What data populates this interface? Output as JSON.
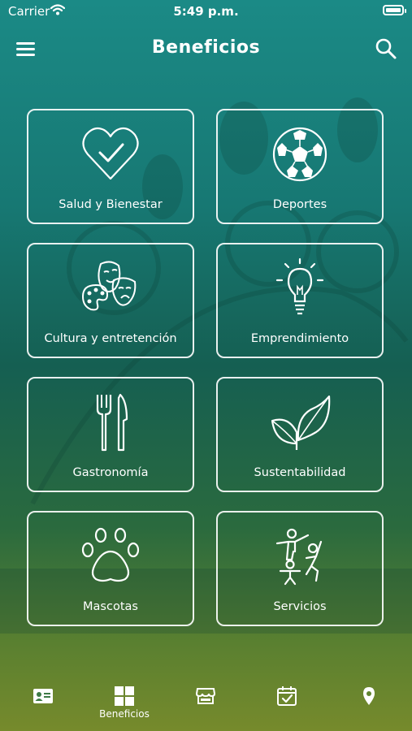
{
  "status_bar": {
    "carrier": "Carrier",
    "time": "5:49 p.m."
  },
  "nav": {
    "title": "Beneficios"
  },
  "categories": [
    {
      "label": "Salud y Bienestar",
      "icon": "heart-check-icon"
    },
    {
      "label": "Deportes",
      "icon": "soccer-ball-icon"
    },
    {
      "label": "Cultura y entretención",
      "icon": "theater-masks-palette-icon"
    },
    {
      "label": "Emprendimiento",
      "icon": "lightbulb-icon"
    },
    {
      "label": "Gastronomía",
      "icon": "fork-knife-icon"
    },
    {
      "label": "Sustentabilidad",
      "icon": "leaves-icon"
    },
    {
      "label": "Mascotas",
      "icon": "paw-icon"
    },
    {
      "label": "Servicios",
      "icon": "family-people-icon"
    }
  ],
  "tab_bar": {
    "active_label": "Beneficios",
    "tabs": [
      {
        "icon": "id-card-icon"
      },
      {
        "icon": "grid-icon"
      },
      {
        "icon": "store-icon"
      },
      {
        "icon": "calendar-check-icon"
      },
      {
        "icon": "location-pin-icon"
      }
    ]
  },
  "colors": {
    "gradient_top": "#1b8a86",
    "gradient_bottom": "#768a2c",
    "foreground": "#ffffff"
  }
}
